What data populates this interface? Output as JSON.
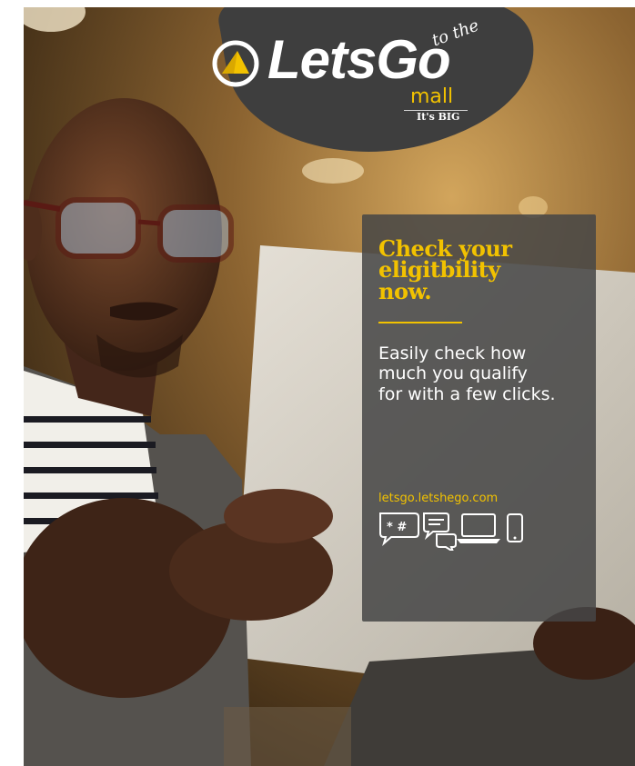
{
  "brand": {
    "name": "LetsGo",
    "script_text": "to the",
    "sub_name": "mall",
    "tagline": "It's BIG",
    "accent_color": "#f2c200",
    "blob_color": "#3e3e3e",
    "logo_icon": "triangle-in-circle-logo-icon"
  },
  "card": {
    "headline_lines": [
      "Check your",
      "eligitbility",
      "now."
    ],
    "body_lines": [
      "Easily check how",
      "much you qualify",
      "for with a few clicks."
    ],
    "url": "letsgo.letshego.com",
    "channel_icons": [
      "ussd-chat-icon",
      "chat-bubbles-icon",
      "laptop-icon",
      "mobile-phone-icon"
    ],
    "ussd_symbols": "* #",
    "card_color": "#464646"
  },
  "photo": {
    "subject": "man-with-tablet-photo"
  }
}
